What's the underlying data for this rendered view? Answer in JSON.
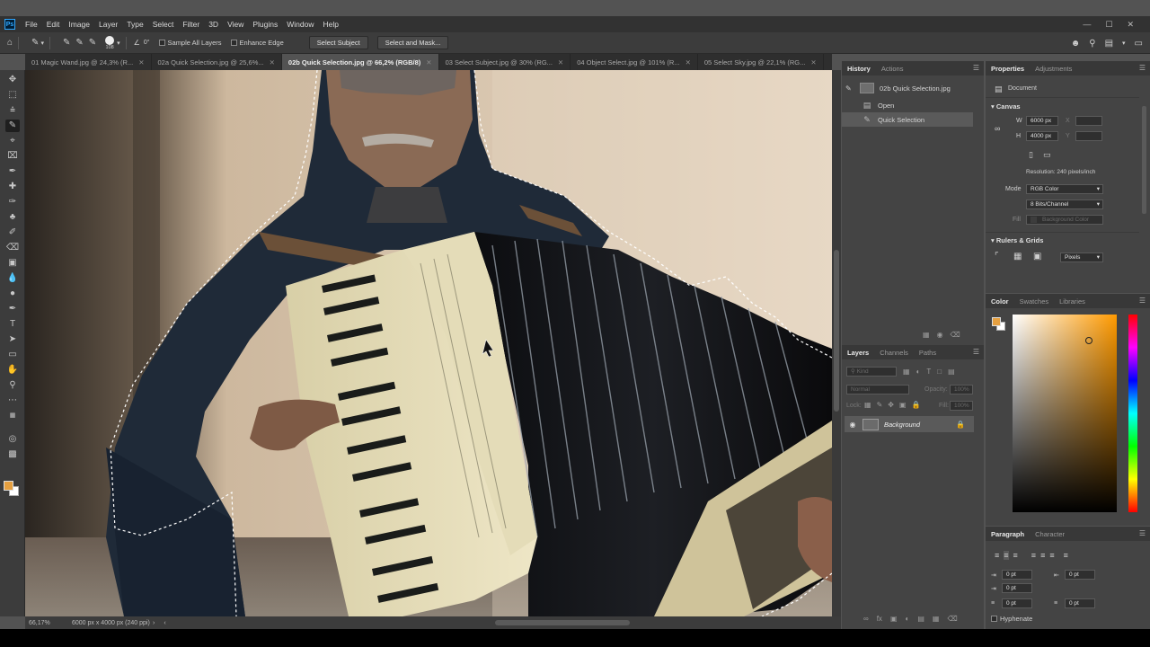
{
  "app": {
    "logo": "Ps"
  },
  "menu": [
    "File",
    "Edit",
    "Image",
    "Layer",
    "Type",
    "Select",
    "Filter",
    "3D",
    "View",
    "Plugins",
    "Window",
    "Help"
  ],
  "options": {
    "brush_size": "108",
    "angle": "0°",
    "sample_all_layers": "Sample All Layers",
    "enhance_edge": "Enhance Edge",
    "select_subject": "Select Subject",
    "select_and_mask": "Select and Mask..."
  },
  "tabs": [
    {
      "label": "01 Magic Wand.jpg @ 24,3% (R..."
    },
    {
      "label": "02a Quick Selection.jpg @ 25,6%..."
    },
    {
      "label": "02b Quick Selection.jpg @ 66,2% (RGB/8)",
      "active": true
    },
    {
      "label": "03 Select Subject.jpg @ 30% (RG..."
    },
    {
      "label": "04 Object Select.jpg @ 101% (R..."
    },
    {
      "label": "05 Select Sky.jpg @ 22,1% (RG..."
    }
  ],
  "status": {
    "zoom": "66,17%",
    "info": "6000 px x 4000 px (240 ppi)"
  },
  "history": {
    "tabs": [
      "History",
      "Actions"
    ],
    "snapshot": "02b Quick Selection.jpg",
    "items": [
      "Open",
      "Quick Selection"
    ]
  },
  "properties": {
    "tabs": [
      "Properties",
      "Adjustments"
    ],
    "doc_label": "Document",
    "canvas_title": "Canvas",
    "w_label": "W",
    "w_value": "6000 px",
    "h_label": "H",
    "h_value": "4000 px",
    "x_label": "X",
    "y_label": "Y",
    "resolution": "Resolution: 240 pixels/inch",
    "mode_label": "Mode",
    "mode_value": "RGB Color",
    "bits_value": "8 Bits/Channel",
    "fill_label": "Fill",
    "fill_value": "Background Color",
    "rulers_title": "Rulers & Grids",
    "units_value": "Pixels"
  },
  "color_panel": {
    "tabs": [
      "Color",
      "Swatches",
      "Libraries"
    ],
    "fg": "#e6a040",
    "picker_hue": "#ff9a00"
  },
  "layers": {
    "tabs": [
      "Layers",
      "Channels",
      "Paths"
    ],
    "kind": "Kind",
    "blend": "Normal",
    "opacity_label": "Opacity:",
    "opacity_value": "100%",
    "lock_label": "Lock:",
    "fill_label": "Fill:",
    "fill_value": "100%",
    "layer_name": "Background"
  },
  "paragraph": {
    "tabs": [
      "Paragraph",
      "Character"
    ],
    "indent_left": "0 pt",
    "indent_right": "0 pt",
    "first_line": "0 pt",
    "space_before": "0 pt",
    "space_after": "0 pt",
    "hyphenate": "Hyphenate"
  }
}
